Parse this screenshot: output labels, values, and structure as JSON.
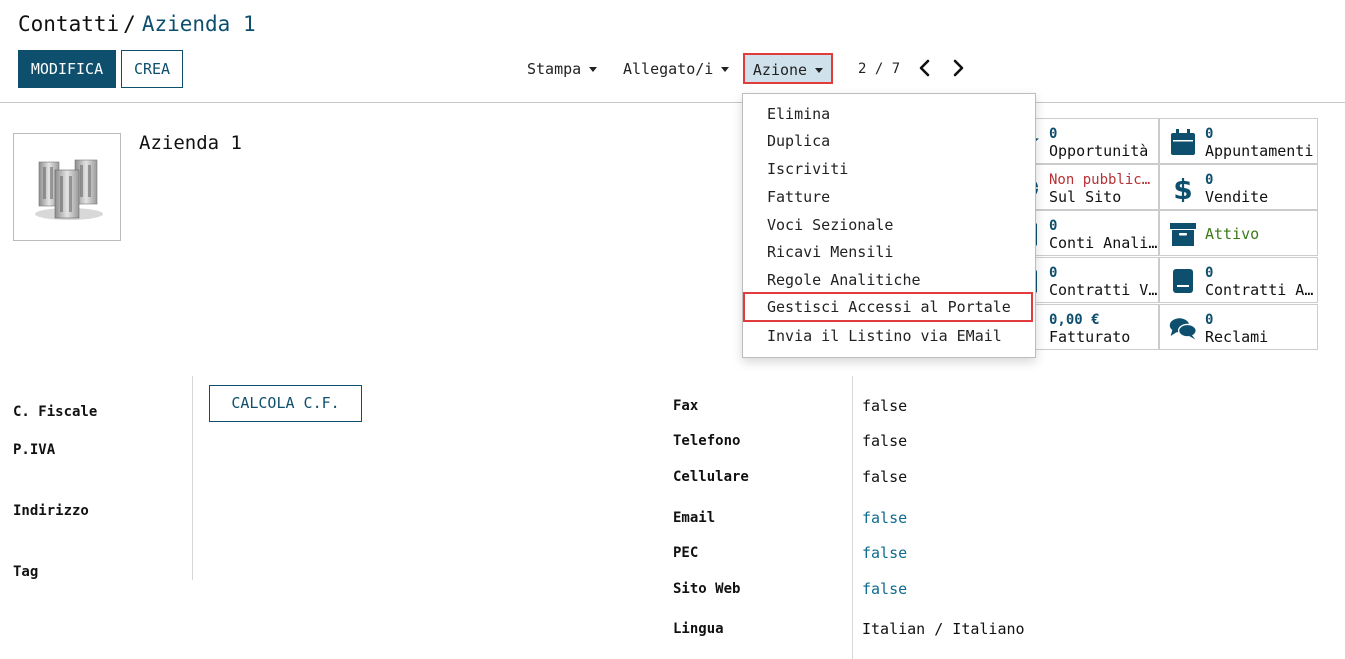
{
  "breadcrumb": {
    "parent": "Contatti",
    "separator": "/",
    "current": "Azienda 1"
  },
  "toolbar": {
    "edit_label": "MODIFICA",
    "create_label": "CREA",
    "print_label": "Stampa",
    "attachment_label": "Allegato/i",
    "action_label": "Azione",
    "pager": "2 / 7"
  },
  "record": {
    "name": "Azienda 1",
    "avatar_icon": "company-buildings-icon"
  },
  "action_menu": {
    "items": [
      "Elimina",
      "Duplica",
      "Iscriviti",
      "Fatture",
      "Voci Sezionale",
      "Ricavi Mensili",
      "Regole Analitiche",
      "Gestisci Accessi al Portale",
      "Invia il Listino via EMail"
    ],
    "highlighted": "Gestisci Accessi al Portale"
  },
  "smart_buttons": {
    "opportunita": {
      "value": "0",
      "label": "Opportunità",
      "icon": "star-icon"
    },
    "appuntamenti": {
      "value": "0",
      "label": "Appuntamenti",
      "icon": "calendar-icon"
    },
    "sito": {
      "value": "Non pubblic…",
      "label": "Sul Sito",
      "icon": "globe-icon"
    },
    "vendite": {
      "value": "0",
      "label": "Vendite",
      "icon": "dollar-icon"
    },
    "conti": {
      "value": "0",
      "label": "Conti Anali…",
      "icon": "book-icon"
    },
    "attivo": {
      "label": "Attivo",
      "icon": "archive-icon"
    },
    "contratti_v": {
      "value": "0",
      "label": "Contratti V…",
      "icon": "book-icon"
    },
    "contratti_a": {
      "value": "0",
      "label": "Contratti A…",
      "icon": "book-icon"
    },
    "fatturato": {
      "value": "0,00 €",
      "label": "Fatturato",
      "icon": "pencil-icon"
    },
    "reclami": {
      "value": "0",
      "label": "Reclami",
      "icon": "comments-icon"
    }
  },
  "left_fields": {
    "cf_label": "C. Fiscale",
    "calc_button": "CALCOLA C.F.",
    "piva_label": "P.IVA",
    "indirizzo_label": "Indirizzo",
    "tag_label": "Tag"
  },
  "right_fields": [
    {
      "label": "Fax",
      "value": "false"
    },
    {
      "label": "Telefono",
      "value": "false"
    },
    {
      "label": "Cellulare",
      "value": "false"
    },
    {
      "label": "Email",
      "value": "false"
    },
    {
      "label": "PEC",
      "value": "false"
    },
    {
      "label": "Sito Web",
      "value": "false"
    },
    {
      "label": "Lingua",
      "value": "Italian / Italiano"
    }
  ],
  "colors": {
    "primary": "#0e4f6e",
    "highlight_border": "#e23b3b",
    "link": "#0e6a8f",
    "unpublished": "#b53135",
    "active": "#3c7a1a"
  }
}
